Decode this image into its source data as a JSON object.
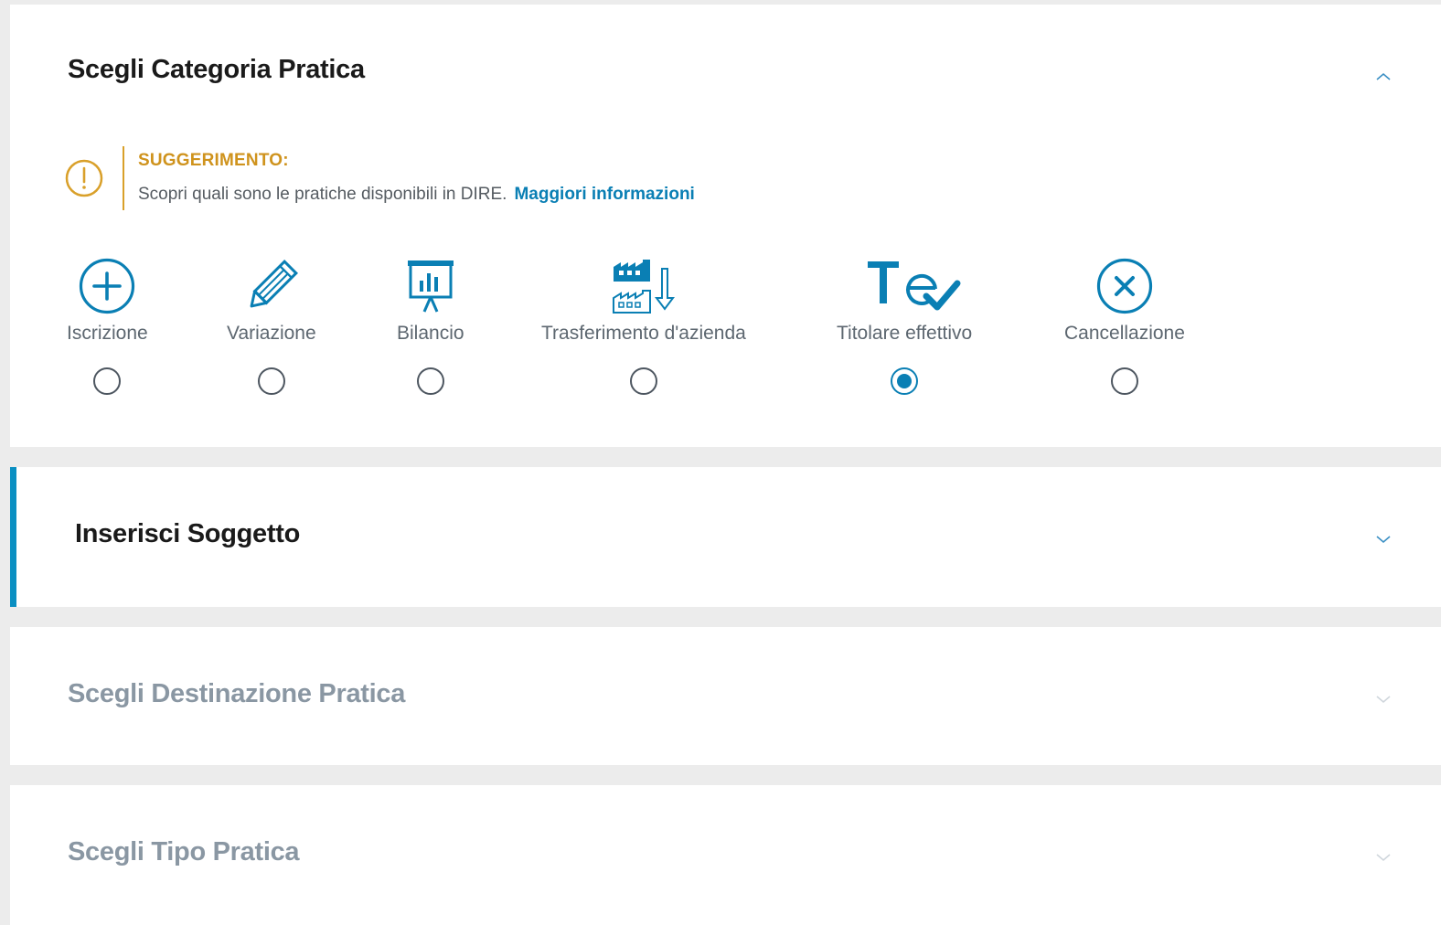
{
  "panels": {
    "categoria": {
      "title": "Scegli Categoria Pratica",
      "expanded": true,
      "tip": {
        "label": "SUGGERIMENTO:",
        "text": "Scopri quali sono le pratiche disponibili in DIRE.",
        "link": "Maggiori informazioni"
      },
      "options": [
        {
          "label": "Iscrizione",
          "icon": "plus-circle-icon",
          "selected": false
        },
        {
          "label": "Variazione",
          "icon": "pencil-icon",
          "selected": false
        },
        {
          "label": "Bilancio",
          "icon": "presentation-chart-icon",
          "selected": false
        },
        {
          "label": "Trasferimento d'azienda",
          "icon": "factory-transfer-icon",
          "selected": false
        },
        {
          "label": "Titolare effettivo",
          "icon": "te-check-icon",
          "selected": true
        },
        {
          "label": "Cancellazione",
          "icon": "x-circle-icon",
          "selected": false
        }
      ]
    },
    "soggetto": {
      "title": "Inserisci Soggetto",
      "active": true
    },
    "destinazione": {
      "title": "Scegli Destinazione Pratica",
      "disabled": true
    },
    "tipo": {
      "title": "Scegli Tipo Pratica",
      "disabled": true
    }
  },
  "colors": {
    "accent": "#0a7fb4",
    "warning": "#cf931d",
    "disabled_text": "#8a97a3"
  }
}
